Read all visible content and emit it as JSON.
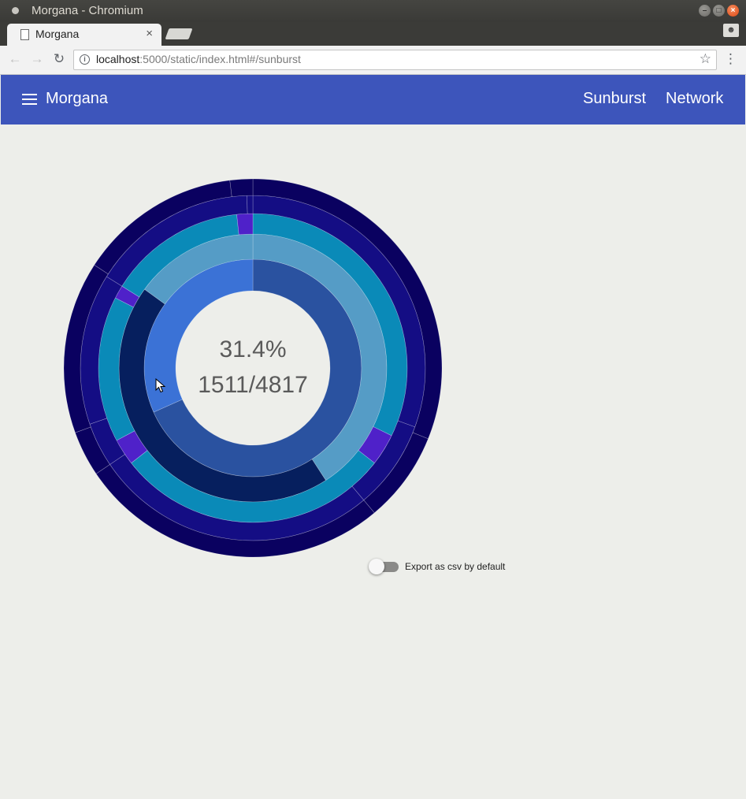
{
  "window": {
    "title": "Morgana - Chromium"
  },
  "browser": {
    "tab_title": "Morgana",
    "tab_close": "×",
    "url_host": "localhost",
    "url_rest": ":5000/static/index.html#/sunburst"
  },
  "app": {
    "name": "Morgana",
    "nav": [
      "Sunburst",
      "Network"
    ]
  },
  "center": {
    "percent": "31.4%",
    "fraction": "1511/4817"
  },
  "settings": {
    "export_csv_label": "Export as csv by default",
    "export_csv_enabled": false
  },
  "colors": {
    "app_bar": "#3d55bb",
    "page_bg": "#edeeea",
    "ring1_a": "#2a52a0",
    "ring1_b": "#3b72d6",
    "ring2_a": "#061f5e",
    "ring2_b": "#559cc6",
    "ring3_teal": "#0a8ab8",
    "ring3_violet": "#4f21c9",
    "ring4": "#140d84",
    "ring5": "#0a0160"
  },
  "chart_data": {
    "type": "sunburst",
    "center_labels": [
      "31.4%",
      "1511/4817"
    ],
    "rings": [
      {
        "level": 1,
        "segments": [
          {
            "start_deg": 0,
            "end_deg": 246,
            "color": "#2a52a0"
          },
          {
            "start_deg": 246,
            "end_deg": 360,
            "color": "#3b72d6"
          }
        ]
      },
      {
        "level": 2,
        "segments": [
          {
            "start_deg": 0,
            "end_deg": 147,
            "color": "#559cc6"
          },
          {
            "start_deg": 147,
            "end_deg": 306,
            "color": "#061f5e"
          },
          {
            "start_deg": 306,
            "end_deg": 360,
            "color": "#559cc6"
          }
        ]
      },
      {
        "level": 3,
        "segments": [
          {
            "start_deg": 0,
            "end_deg": 116,
            "color": "#0a8ab8"
          },
          {
            "start_deg": 116,
            "end_deg": 128,
            "color": "#4f21c9"
          },
          {
            "start_deg": 128,
            "end_deg": 232,
            "color": "#0a8ab8"
          },
          {
            "start_deg": 232,
            "end_deg": 242,
            "color": "#4f21c9"
          },
          {
            "start_deg": 242,
            "end_deg": 297,
            "color": "#0a8ab8"
          },
          {
            "start_deg": 297,
            "end_deg": 302,
            "color": "#4f21c9"
          },
          {
            "start_deg": 302,
            "end_deg": 354,
            "color": "#0a8ab8"
          },
          {
            "start_deg": 354,
            "end_deg": 360,
            "color": "#4f21c9"
          }
        ]
      },
      {
        "level": 4,
        "segments": [
          {
            "start_deg": 0,
            "end_deg": 110,
            "color": "#140d84"
          },
          {
            "start_deg": 110,
            "end_deg": 140,
            "color": "#140d84"
          },
          {
            "start_deg": 140,
            "end_deg": 236,
            "color": "#140d84"
          },
          {
            "start_deg": 236,
            "end_deg": 251,
            "color": "#140d84"
          },
          {
            "start_deg": 251,
            "end_deg": 302,
            "color": "#140d84"
          },
          {
            "start_deg": 302,
            "end_deg": 358,
            "color": "#140d84"
          },
          {
            "start_deg": 358,
            "end_deg": 360,
            "color": "#140d84"
          }
        ]
      },
      {
        "level": 5,
        "segments": [
          {
            "start_deg": 0,
            "end_deg": 112,
            "color": "#0a0160"
          },
          {
            "start_deg": 112,
            "end_deg": 140,
            "color": "#0a0160"
          },
          {
            "start_deg": 140,
            "end_deg": 236,
            "color": "#0a0160"
          },
          {
            "start_deg": 236,
            "end_deg": 250,
            "color": "#0a0160"
          },
          {
            "start_deg": 250,
            "end_deg": 303,
            "color": "#0a0160"
          },
          {
            "start_deg": 303,
            "end_deg": 353,
            "color": "#0a0160"
          },
          {
            "start_deg": 353,
            "end_deg": 360,
            "color": "#0a0160"
          }
        ]
      }
    ]
  }
}
